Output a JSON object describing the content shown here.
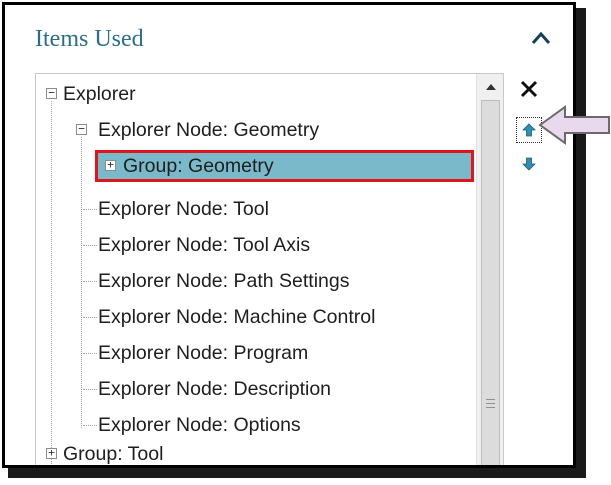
{
  "panel": {
    "title": "Items Used",
    "collapse_icon": "chevron-up-icon"
  },
  "tree": {
    "items": [
      {
        "label": "Explorer",
        "level": 0,
        "expander": "−"
      },
      {
        "label": "Explorer Node: Geometry",
        "level": 1,
        "expander": "−"
      },
      {
        "label": "Group: Geometry",
        "level": 2,
        "expander": "+",
        "selected": true
      },
      {
        "label": "Explorer Node: Tool",
        "level": 1
      },
      {
        "label": "Explorer Node: Tool Axis",
        "level": 1
      },
      {
        "label": "Explorer Node: Path Settings",
        "level": 1
      },
      {
        "label": "Explorer Node: Machine Control",
        "level": 1
      },
      {
        "label": "Explorer Node: Program",
        "level": 1
      },
      {
        "label": "Explorer Node: Description",
        "level": 1
      },
      {
        "label": "Explorer Node: Options",
        "level": 1
      },
      {
        "label": "Group: Tool",
        "level": 0,
        "expander": "+"
      }
    ]
  },
  "side_buttons": {
    "delete_icon": "close-icon",
    "move_up_icon": "arrow-up-icon",
    "move_down_icon": "arrow-down-icon"
  },
  "colors": {
    "title": "#2c6d8a",
    "selection_fill": "#7ab9c9",
    "selection_border": "#e0151c",
    "arrow_icon": "#2f8fb3",
    "pointer_fill": "#e9d9ee"
  }
}
